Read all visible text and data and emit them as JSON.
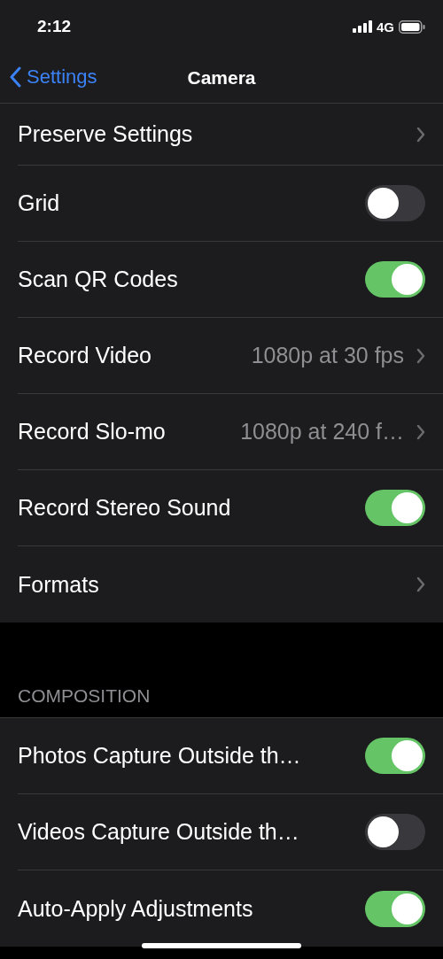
{
  "status_bar": {
    "time": "2:12",
    "network": "4G"
  },
  "nav": {
    "back": "Settings",
    "title": "Camera"
  },
  "groups": [
    {
      "rows": [
        {
          "kind": "link",
          "label": "Preserve Settings"
        },
        {
          "kind": "toggle",
          "label": "Grid",
          "on": false
        },
        {
          "kind": "toggle",
          "label": "Scan QR Codes",
          "on": true
        },
        {
          "kind": "link",
          "label": "Record Video",
          "value": "1080p at 30 fps"
        },
        {
          "kind": "link",
          "label": "Record Slo-mo",
          "value": "1080p at 240 f…"
        },
        {
          "kind": "toggle",
          "label": "Record Stereo Sound",
          "on": true
        },
        {
          "kind": "link",
          "label": "Formats"
        }
      ]
    },
    {
      "header": "COMPOSITION",
      "rows": [
        {
          "kind": "toggle",
          "label": "Photos Capture Outside th…",
          "on": true
        },
        {
          "kind": "toggle",
          "label": "Videos Capture Outside th…",
          "on": false
        },
        {
          "kind": "toggle",
          "label": "Auto-Apply Adjustments",
          "on": true
        }
      ]
    }
  ]
}
